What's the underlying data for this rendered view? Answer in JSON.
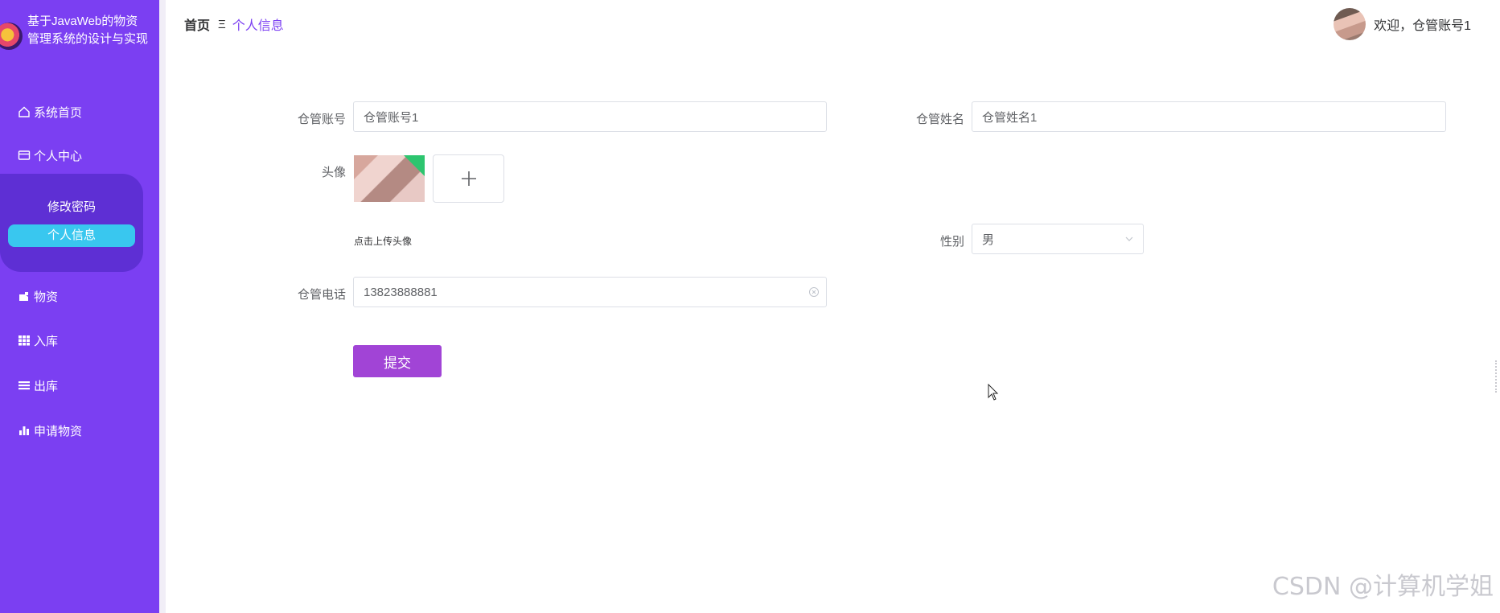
{
  "app": {
    "title": "基于JavaWeb的物资管理系统的设计与实现"
  },
  "sidebar": {
    "items": [
      {
        "label": "系统首页",
        "icon": "home-icon"
      },
      {
        "label": "个人中心",
        "icon": "id-card-icon"
      },
      {
        "label": "物资",
        "icon": "tag-icon"
      },
      {
        "label": "入库",
        "icon": "grid-icon"
      },
      {
        "label": "出库",
        "icon": "menu-icon"
      },
      {
        "label": "申请物资",
        "icon": "bar-chart-icon"
      }
    ],
    "submenu": [
      {
        "label": "修改密码"
      },
      {
        "label": "个人信息"
      }
    ],
    "color": "#7b3ff2"
  },
  "header": {
    "breadcrumb_home": "首页",
    "breadcrumb_sep": "Ξ",
    "breadcrumb_current": "个人信息",
    "welcome": "欢迎，仓管账号1"
  },
  "form": {
    "account_label": "仓管账号",
    "account_value": "仓管账号1",
    "name_label": "仓管姓名",
    "name_value": "仓管姓名1",
    "avatar_label": "头像",
    "upload_hint": "点击上传头像",
    "gender_label": "性别",
    "gender_value": "男",
    "phone_label": "仓管电话",
    "phone_value": "13823888881",
    "submit_label": "提交",
    "submit_color": "#a144d6"
  },
  "watermark": "CSDN @计算机学姐"
}
